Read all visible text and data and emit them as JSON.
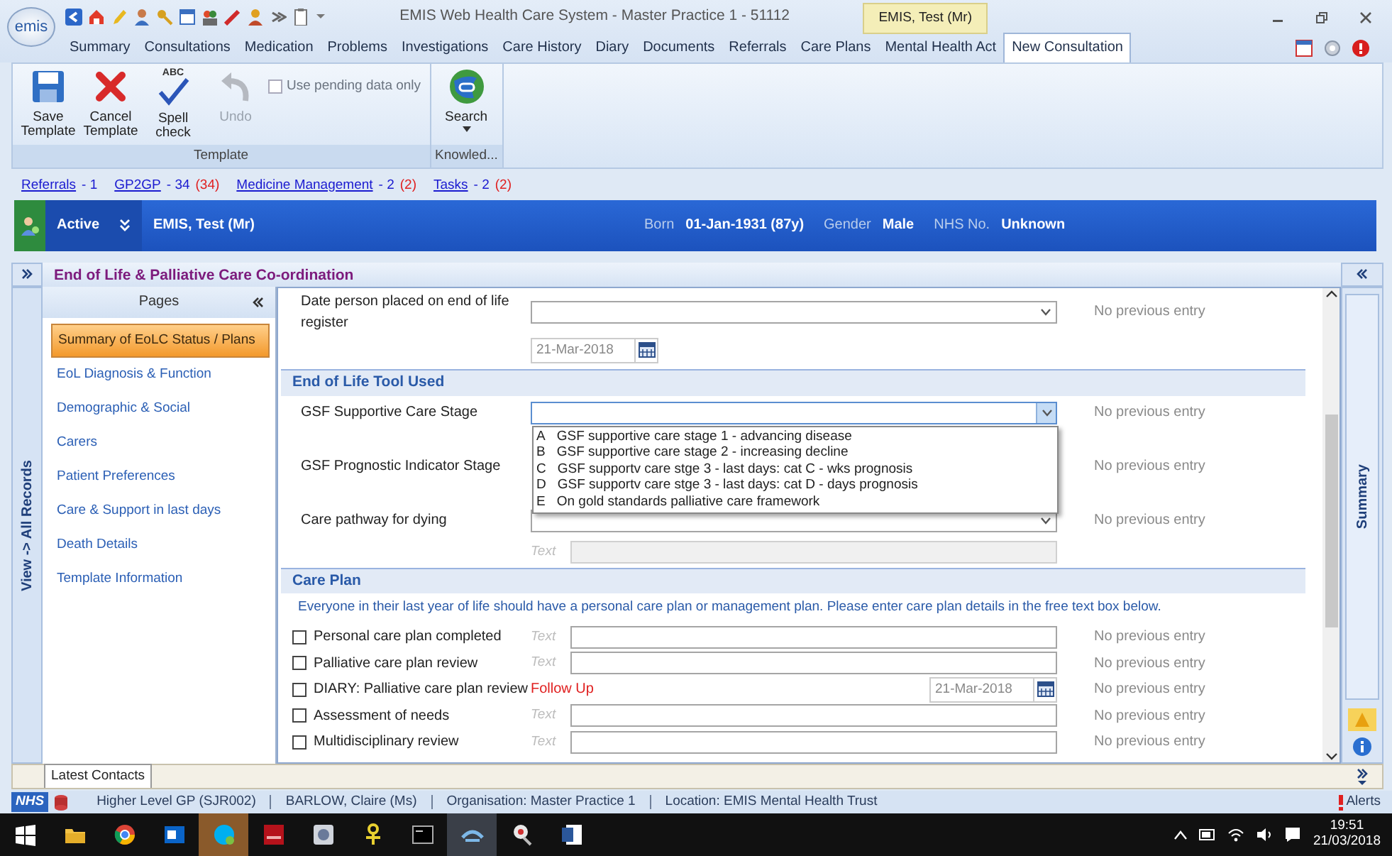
{
  "window": {
    "title": "EMIS Web Health Care System - Master Practice 1 - 51112",
    "context_tab": "EMIS, Test (Mr)"
  },
  "app_logo": "emis",
  "menu_tabs": [
    {
      "label": "Summary",
      "selected": false
    },
    {
      "label": "Consultations",
      "selected": false
    },
    {
      "label": "Medication",
      "selected": false
    },
    {
      "label": "Problems",
      "selected": false
    },
    {
      "label": "Investigations",
      "selected": false
    },
    {
      "label": "Care History",
      "selected": false
    },
    {
      "label": "Diary",
      "selected": false
    },
    {
      "label": "Documents",
      "selected": false
    },
    {
      "label": "Referrals",
      "selected": false
    },
    {
      "label": "Care Plans",
      "selected": false
    },
    {
      "label": "Mental Health Act",
      "selected": false
    },
    {
      "label": "New Consultation",
      "selected": true
    }
  ],
  "ribbon": {
    "groups": [
      {
        "label": "Template",
        "buttons": [
          {
            "label": "Save Template",
            "kind": "save",
            "disabled": false
          },
          {
            "label": "Cancel Template",
            "kind": "cancel",
            "disabled": false
          },
          {
            "label": "Spell check",
            "kind": "spell",
            "icon_text": "ABC",
            "disabled": false
          },
          {
            "label": "Undo",
            "kind": "undo",
            "disabled": true
          }
        ],
        "checkbox": {
          "label": "Use pending data only",
          "checked": false,
          "disabled": true
        }
      },
      {
        "label": "Knowled...",
        "buttons": [
          {
            "label": "Search",
            "kind": "search",
            "disabled": false,
            "dropdown": true
          }
        ]
      }
    ]
  },
  "task_links": [
    {
      "label": "Referrals",
      "count": "- 1"
    },
    {
      "label": "GP2GP",
      "count": "- 34",
      "unread": "(34)"
    },
    {
      "label": "Medicine Management",
      "count": "- 2",
      "unread": "(2)"
    },
    {
      "label": "Tasks",
      "count": "- 2",
      "unread": "(2)"
    }
  ],
  "patient": {
    "status": "Active",
    "name": "EMIS, Test (Mr)",
    "details": [
      {
        "label": "Born",
        "value": "01-Jan-1931 (87y)"
      },
      {
        "label": "Gender",
        "value": "Male"
      },
      {
        "label": "NHS No.",
        "value": "Unknown"
      }
    ]
  },
  "template": {
    "title": "End of Life & Palliative Care Co-ordination",
    "side_tab": "View -> All Records",
    "summary_tab": "Summary",
    "pages_heading": "Pages",
    "pages": [
      {
        "label": "Summary of EoLC Status / Plans",
        "selected": true
      },
      {
        "label": "EoL Diagnosis & Function",
        "selected": false
      },
      {
        "label": "Demographic & Social",
        "selected": false
      },
      {
        "label": "Carers",
        "selected": false
      },
      {
        "label": "Patient Preferences",
        "selected": false
      },
      {
        "label": "Care & Support in last days",
        "selected": false
      },
      {
        "label": "Death Details",
        "selected": false
      },
      {
        "label": "Template Information",
        "selected": false
      }
    ]
  },
  "form": {
    "sections": [
      {
        "rows": [
          {
            "kind": "dropdown",
            "label": "Date person placed on end of life register",
            "previous": "No previous entry",
            "date": "21-Mar-2018"
          }
        ]
      },
      {
        "heading": "End of Life Tool Used",
        "rows": [
          {
            "kind": "dropdown",
            "label": "GSF Supportive Care Stage",
            "previous": "No previous entry",
            "focused": true,
            "expanded": true,
            "options": [
              {
                "letter": "A",
                "text": "GSF supportive care stage 1 - advancing disease"
              },
              {
                "letter": "B",
                "text": "GSF supportive care stage 2 - increasing decline"
              },
              {
                "letter": "C",
                "text": "GSF supportv care stge 3 - last days: cat C - wks prognosis"
              },
              {
                "letter": "D",
                "text": "GSF supportv care stge 3 - last days: cat D - days prognosis"
              },
              {
                "letter": "E",
                "text": "On gold standards palliative care framework"
              }
            ]
          },
          {
            "kind": "covered",
            "label": "GSF Prognostic Indicator Stage",
            "previous": "No previous entry"
          },
          {
            "kind": "dropdown",
            "label": "Care pathway for dying",
            "previous": "No previous entry",
            "text_label": "Text",
            "text_disabled": true
          }
        ]
      },
      {
        "heading": "Care Plan",
        "intro": "Everyone in their last year of life should have a personal care plan or management plan.  Please enter care plan details in the free text box below.",
        "rows": [
          {
            "kind": "check-text",
            "label": "Personal care plan completed",
            "checked": false,
            "text_label": "Text",
            "previous": "No previous entry"
          },
          {
            "kind": "check-text",
            "label": "Palliative care plan review",
            "checked": false,
            "text_label": "Text",
            "previous": "No previous entry"
          },
          {
            "kind": "check-date",
            "label": "DIARY: Palliative care plan review",
            "checked": false,
            "flag": "Follow Up",
            "date": "21-Mar-2018",
            "previous": "No previous entry"
          },
          {
            "kind": "check-text",
            "label": "Assessment of needs",
            "checked": false,
            "text_label": "Text",
            "previous": "No previous entry"
          },
          {
            "kind": "check-text",
            "label": "Multidisciplinary review",
            "checked": false,
            "text_label": "Text",
            "previous": "No previous entry"
          }
        ]
      }
    ]
  },
  "bottom_tabs": [
    {
      "label": "Latest Contacts",
      "selected": true
    }
  ],
  "status_bar": {
    "logo": "NHS",
    "items": [
      "Higher Level  GP (SJR002)",
      "BARLOW, Claire (Ms)",
      "Organisation: Master Practice 1",
      "Location:  EMIS Mental Health Trust"
    ],
    "alerts": "Alerts"
  },
  "taskbar": {
    "time": "19:51",
    "date": "21/03/2018"
  }
}
